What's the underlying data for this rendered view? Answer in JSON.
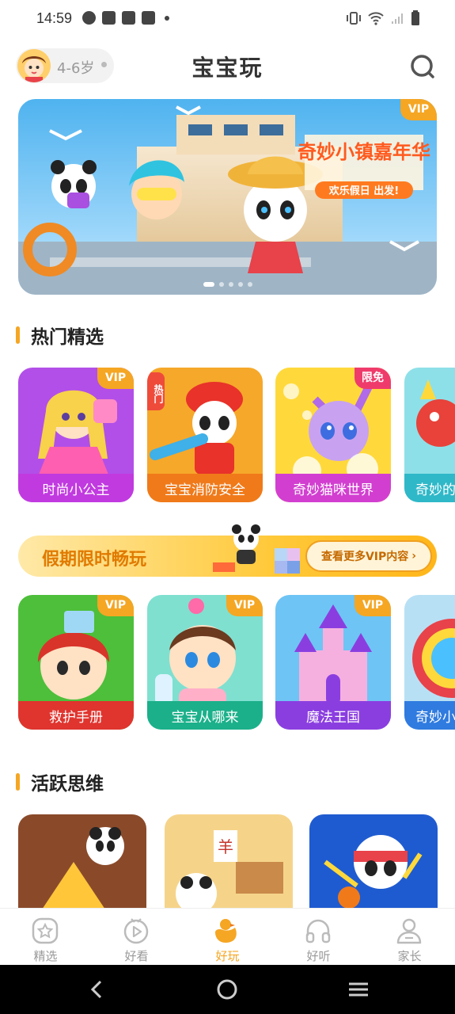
{
  "status_bar": {
    "time": "14:59"
  },
  "header": {
    "age_label": "4-6岁",
    "title": "宝宝玩"
  },
  "banner": {
    "badge": "VIP",
    "title": "奇妙小镇嘉年华",
    "subtitle": "欢乐假日 出发!"
  },
  "sections": {
    "hot": {
      "title": "热门精选",
      "cards": [
        {
          "label": "时尚小公主",
          "badge": "VIP",
          "color": "#c13ae0"
        },
        {
          "label": "宝宝消防安全",
          "badge": "热门",
          "color": "#f07a1a"
        },
        {
          "label": "奇妙猫咪世界",
          "badge": "限免",
          "color": "#d23fd0"
        },
        {
          "label": "奇妙的",
          "badge": "",
          "color": "#2fb8c8"
        }
      ]
    },
    "promo": {
      "text": "假期限时畅玩",
      "button": "查看更多VIP内容"
    },
    "vip": {
      "cards": [
        {
          "label": "救护手册",
          "badge": "VIP",
          "color": "#e0342e"
        },
        {
          "label": "宝宝从哪来",
          "badge": "VIP",
          "color": "#1bb08a"
        },
        {
          "label": "魔法王国",
          "badge": "VIP",
          "color": "#8b3ee0"
        },
        {
          "label": "奇妙小",
          "badge": "",
          "color": "#2f7be0"
        }
      ]
    },
    "thinking": {
      "title": "活跃思维"
    }
  },
  "bottom_nav": {
    "items": [
      {
        "label": "精选",
        "icon": "star-badge-icon"
      },
      {
        "label": "好看",
        "icon": "play-icon"
      },
      {
        "label": "好玩",
        "icon": "duck-icon"
      },
      {
        "label": "好听",
        "icon": "headphones-icon"
      },
      {
        "label": "家长",
        "icon": "person-icon"
      }
    ],
    "active": "好玩"
  },
  "colors": {
    "accent": "#f5a623",
    "vip": "#f5a623",
    "hot": "#ef4b3b"
  }
}
